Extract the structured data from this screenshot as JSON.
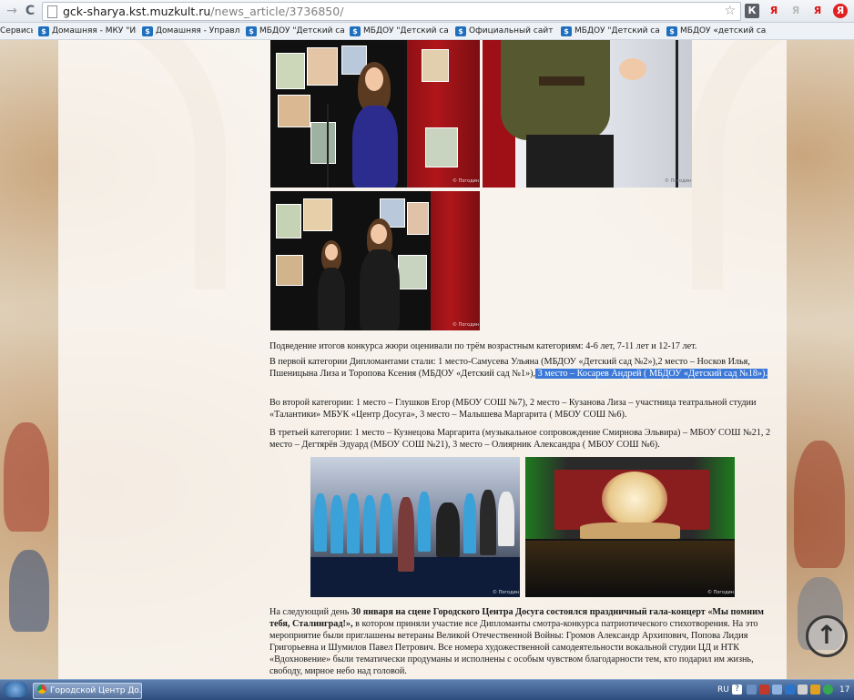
{
  "browser": {
    "url_domain": "gck-sharya.kst.muzkult.ru",
    "url_path": "/news_article/3736850/",
    "back_glyph": "→",
    "reload_glyph": "C",
    "star_glyph": "☆",
    "ext_labels": [
      "К",
      "Я",
      "Я",
      "Я"
    ]
  },
  "bookmarks": [
    "Сервисы",
    "Домашняя - МКУ \"Инф",
    "Домашняя - Управлени",
    "МБДОУ \"Детский сад \"",
    "МБДОУ \"Детский сад \"",
    "Официальный сайт МБ",
    "МБДОУ \"Детский сад \"",
    "МБДОУ «детский сад \""
  ],
  "article": {
    "p1": "Подведение итогов конкурса жюри оценивали по трём возрастным категориям:  4-6 лет, 7-11 лет и 12-17 лет.",
    "p2_plain": "В первой категории Дипломантами стали: 1 место-Самусева Ульяна (МБДОУ «Детский сад №2»),2 место – Носков Илья, Пшеницына Лиза и Торопова Ксения (МБДОУ «Детский сад №1»),",
    "p2_selected": " 3 место – Косарев Андрей ( МБДОУ «Детский сад №18»).",
    "p3": "Во второй категории: 1 место – Глушков Егор (МБОУ СОШ №7), 2 место – Кузанова Лиза – участница театральной студии «Талантики» МБУК «Центр Досуга», 3 место – Малышева Маргарита ( МБОУ СОШ №6).",
    "p4": " В третьей категории: 1 место – Кузнецова Маргарита (музыкальное сопровождение Смирнова Эльвира) – МБОУ СОШ №21, 2 место – Дегтярёв Эдуард (МБОУ СОШ №21), 3 место – Олиярник Александра ( МБОУ СОШ №6).",
    "p5_lead": "На следующий день ",
    "p5_bold": "30 января на сцене Городского Центра Досуга состоялся праздничный гала-концерт «Мы помним тебя, Сталинград!»,",
    "p5_rest": " в котором приняли участие все Дипломанты смотра-конкурса патриотического стихотворения. На это мероприятие были приглашены ветераны Великой Отечественной Войны: Громов Александр Архипович, Попова Лидия Григорьевна и Шумилов Павел Петрович. Все номера художественной самодеятельности вокальной студии ЦД и НТК «Вдохновение»  были тематически продуманы и исполнены с особым чувством благодарности тем, кто подарил им жизнь, свободу, мирное небо над головой."
  },
  "photo_credit": "© Погодин",
  "taskbar": {
    "window_title": "Городской Центр До...",
    "lang": "RU",
    "clock": "17"
  },
  "colors": {
    "selection": "#3b78d8",
    "taskbar": "#2c4d7e"
  }
}
